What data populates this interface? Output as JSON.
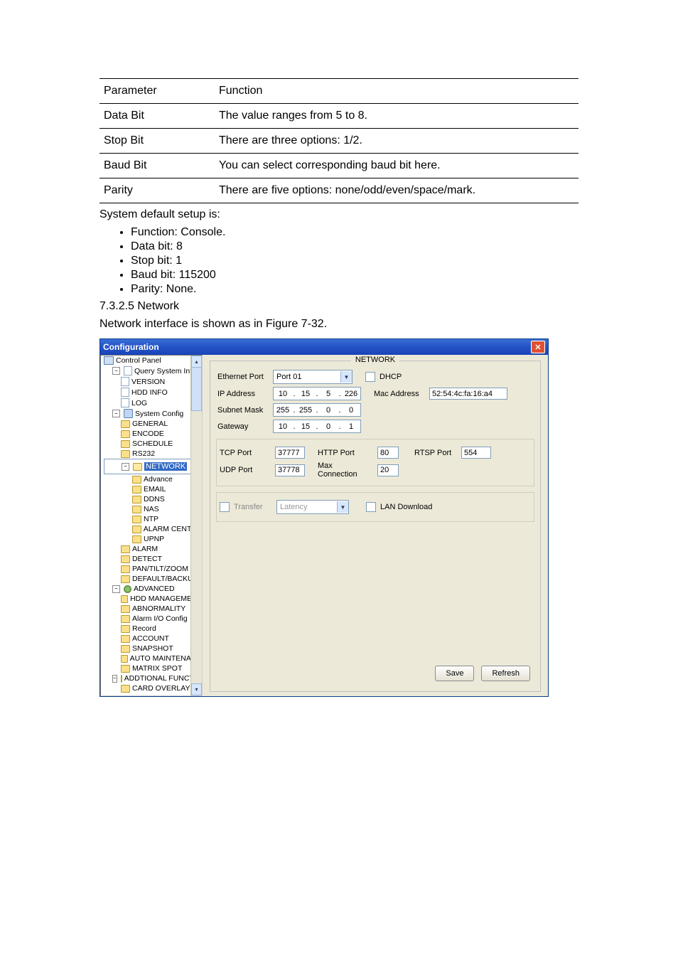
{
  "table": {
    "h1": "Parameter",
    "h2": "Function",
    "rows": [
      {
        "p": "Data Bit",
        "f": "The value ranges from 5 to 8."
      },
      {
        "p": "Stop Bit",
        "f": "There are three options: 1/2."
      },
      {
        "p": "Baud Bit",
        "f": "You can select corresponding baud bit here."
      },
      {
        "p": "Parity",
        "f": "There are five options: none/odd/even/space/mark."
      }
    ]
  },
  "text": {
    "default_intro": "System default setup is:",
    "bullets": [
      "Function: Console.",
      "Data bit: 8",
      "Stop bit: 1",
      "Baud bit: 115200",
      "Parity: None."
    ],
    "section": "7.3.2.5  Network",
    "fig_intro": "Network interface is shown as in Figure 7-32."
  },
  "win": {
    "title": "Configuration",
    "tree": {
      "root": "Control Panel",
      "qsi": "Query System Info",
      "version": "VERSION",
      "hdd_info": "HDD INFO",
      "log": "LOG",
      "sysconf": "System Config",
      "general": "GENERAL",
      "encode": "ENCODE",
      "schedule": "SCHEDULE",
      "rs232": "RS232",
      "network": "NETWORK",
      "advance": "Advance",
      "email": "EMAIL",
      "ddns": "DDNS",
      "nas": "NAS",
      "ntp": "NTP",
      "alarm_center": "ALARM CENTER",
      "upnp": "UPNP",
      "alarm": "ALARM",
      "detect": "DETECT",
      "ptz": "PAN/TILT/ZOOM",
      "defback": "DEFAULT/BACKUP",
      "advanced": "ADVANCED",
      "hdd_mgmt": "HDD MANAGEMENT",
      "abnorm": "ABNORMALITY",
      "alarm_io": "Alarm I/O Config",
      "record": "Record",
      "account": "ACCOUNT",
      "snapshot": "SNAPSHOT",
      "automaint": "AUTO MAINTENANC",
      "matrix": "MATRIX SPOT",
      "addfunc": "ADDTIONAL FUNCTION",
      "card": "CARD OVERLAY"
    },
    "panel": {
      "title": "NETWORK",
      "eth_label": "Ethernet Port",
      "eth_value": "Port 01",
      "dhcp": "DHCP",
      "ip_label": "IP Address",
      "ip": [
        "10",
        "15",
        "5",
        "226"
      ],
      "mac_label": "Mac Address",
      "mac_value": "52:54:4c:fa:16:a4",
      "subnet_label": "Subnet Mask",
      "subnet": [
        "255",
        "255",
        "0",
        "0"
      ],
      "gateway_label": "Gateway",
      "gateway": [
        "10",
        "15",
        "0",
        "1"
      ],
      "tcp_label": "TCP Port",
      "tcp_value": "37777",
      "http_label": "HTTP Port",
      "http_value": "80",
      "rtsp_label": "RTSP Port",
      "rtsp_value": "554",
      "udp_label": "UDP Port",
      "udp_value": "37778",
      "maxconn_label": "Max Connection",
      "maxconn_value": "20",
      "transfer": "Transfer",
      "latency": "Latency",
      "lan_dl": "LAN Download",
      "save": "Save",
      "refresh": "Refresh"
    }
  }
}
